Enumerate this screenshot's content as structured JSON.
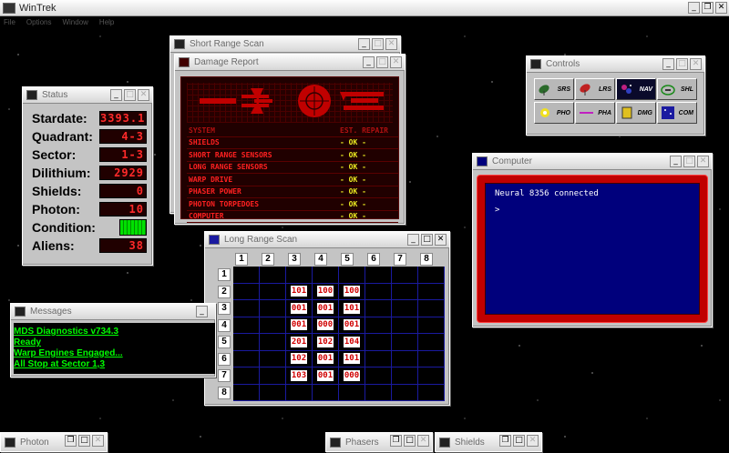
{
  "app": {
    "title": "WinTrek",
    "menu": [
      "File",
      "Options",
      "Window",
      "Help"
    ]
  },
  "colors": {
    "lcd_red": "#ff2a2a",
    "message_green": "#00ff00",
    "computer_blue": "#00007c",
    "computer_frame": "#c00000",
    "damage_ok": "#e8e820"
  },
  "status": {
    "title": "Status",
    "rows": [
      {
        "label": "Stardate:",
        "value": "3393.1"
      },
      {
        "label": "Quadrant:",
        "value": "4-3"
      },
      {
        "label": "Sector:",
        "value": "1-3"
      },
      {
        "label": "Dilithium:",
        "value": "2929"
      },
      {
        "label": "Shields:",
        "value": "0"
      },
      {
        "label": "Photon:",
        "value": "10"
      }
    ],
    "condition_label": "Condition:",
    "aliens_label": "Aliens:",
    "aliens_value": "38"
  },
  "short_range_scan": {
    "title": "Short Range Scan"
  },
  "damage_report": {
    "title": "Damage Report",
    "header": {
      "system": "SYSTEM",
      "status": "EST. REPAIR"
    },
    "rows": [
      {
        "system": "SHIELDS",
        "status": "- OK -"
      },
      {
        "system": "SHORT RANGE SENSORS",
        "status": "- OK -"
      },
      {
        "system": "LONG RANGE SENSORS",
        "status": "- OK -"
      },
      {
        "system": "WARP DRIVE",
        "status": "- OK -"
      },
      {
        "system": "PHASER POWER",
        "status": "- OK -"
      },
      {
        "system": "PHOTON TORPEDOES",
        "status": "- OK -"
      },
      {
        "system": "COMPUTER",
        "status": "- OK -"
      }
    ]
  },
  "controls": {
    "title": "Controls",
    "buttons": [
      {
        "label": "SRS",
        "icon": "satellite-dish-icon"
      },
      {
        "label": "LRS",
        "icon": "radar-dish-icon"
      },
      {
        "label": "NAV",
        "icon": "nebula-icon"
      },
      {
        "label": "SHL",
        "icon": "shield-ship-icon"
      },
      {
        "label": "PHO",
        "icon": "photon-burst-icon"
      },
      {
        "label": "PHA",
        "icon": "phaser-beam-icon"
      },
      {
        "label": "DMG",
        "icon": "damage-panel-icon"
      },
      {
        "label": "COM",
        "icon": "computer-screen-icon"
      }
    ]
  },
  "computer": {
    "title": "Computer",
    "lines": [
      "Neural 8356 connected",
      ">"
    ]
  },
  "long_range_scan": {
    "title": "Long Range Scan",
    "columns": [
      "1",
      "2",
      "3",
      "4",
      "5",
      "6",
      "7",
      "8"
    ],
    "rows": [
      {
        "label": "1",
        "cells": [
          "",
          "",
          "",
          "",
          "",
          "",
          "",
          ""
        ]
      },
      {
        "label": "2",
        "cells": [
          "",
          "",
          "101",
          "100",
          "100",
          "",
          "",
          ""
        ]
      },
      {
        "label": "3",
        "cells": [
          "",
          "",
          "001",
          "001",
          "101",
          "",
          "",
          ""
        ]
      },
      {
        "label": "4",
        "cells": [
          "",
          "",
          "001",
          "000",
          "001",
          "",
          "",
          ""
        ]
      },
      {
        "label": "5",
        "cells": [
          "",
          "",
          "201",
          "102",
          "104",
          "",
          "",
          ""
        ]
      },
      {
        "label": "6",
        "cells": [
          "",
          "",
          "102",
          "001",
          "101",
          "",
          "",
          ""
        ]
      },
      {
        "label": "7",
        "cells": [
          "",
          "",
          "103",
          "001",
          "000",
          "",
          "",
          ""
        ]
      },
      {
        "label": "8",
        "cells": [
          "",
          "",
          "",
          "",
          "",
          "",
          "",
          ""
        ]
      }
    ]
  },
  "messages": {
    "title": "Messages",
    "lines": [
      "MDS Diagnostics v734.3",
      "Ready",
      "Warp Engines Engaged...",
      "All Stop at Sector 1,3"
    ]
  },
  "minimized": [
    {
      "title": "Photon"
    },
    {
      "title": "Phasers"
    },
    {
      "title": "Shields"
    }
  ]
}
